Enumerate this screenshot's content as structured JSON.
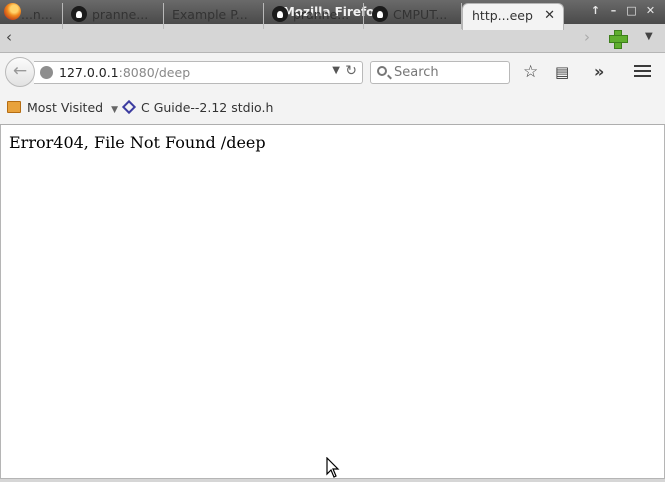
{
  "window": {
    "title": "Mozilla Firefox"
  },
  "tabs": [
    {
      "label": "...n...",
      "icon": "none",
      "active": false
    },
    {
      "label": "pranne...",
      "icon": "github-icon",
      "active": false
    },
    {
      "label": "Example P...",
      "icon": "none",
      "active": false
    },
    {
      "label": "pranne...",
      "icon": "github-icon",
      "active": false
    },
    {
      "label": "CMPUT...",
      "icon": "github-icon",
      "active": false
    },
    {
      "label": "http...eep",
      "icon": "none",
      "active": true
    }
  ],
  "navbar": {
    "url_host": "127.0.0.1",
    "url_rest": ":8080/deep",
    "search_placeholder": "Search"
  },
  "bookmarks": [
    {
      "label": "Most Visited",
      "icon": "folder-icon"
    },
    {
      "label": "C Guide--2.12 stdio.h",
      "icon": "bookmark-diamond-icon"
    }
  ],
  "page": {
    "message": "Error404, File Not Found /deep"
  },
  "colors": {
    "titlebar": "#555555",
    "chrome": "#f3f3f3",
    "tabstrip": "#d6d6d6",
    "newtab_plus": "#5fae2e"
  }
}
